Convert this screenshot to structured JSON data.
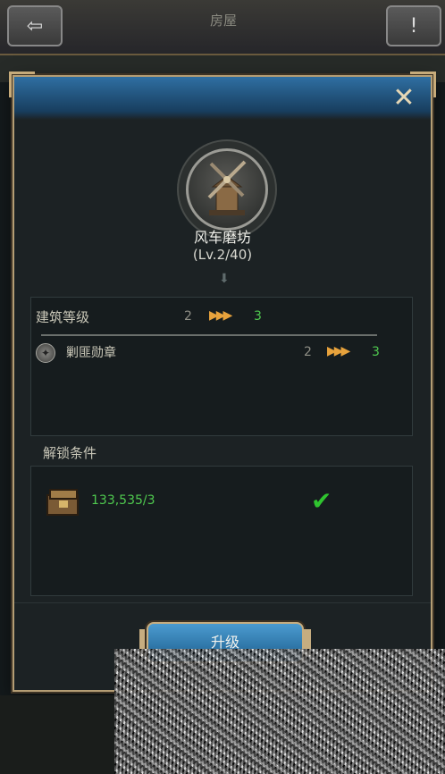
{
  "topbar": {
    "title": "房屋",
    "back_icon": "back-arrow-icon",
    "info_icon": "exclamation-icon"
  },
  "dialog": {
    "close_icon": "close-x-icon",
    "building": {
      "name": "风车磨坊",
      "level": "(Lv.2/40)",
      "icon": "windmill-icon"
    },
    "upgrade_info": {
      "label": "建筑等级",
      "from": "2",
      "to": "3",
      "reward": {
        "icon": "medal-icon",
        "label": "剿匪勋章",
        "from": "2",
        "to": "3"
      }
    },
    "unlock": {
      "title": "解锁条件",
      "resource": {
        "icon": "resource-chest-icon",
        "value": "133,535/3"
      },
      "status_icon": "check-icon"
    },
    "upgrade_button": {
      "label": "升级"
    }
  },
  "colors": {
    "accent_blue": "#2f6fa2",
    "gold_border": "#b49d74",
    "green": "#4fc94f",
    "arrow_orange": "#e7a23c"
  }
}
